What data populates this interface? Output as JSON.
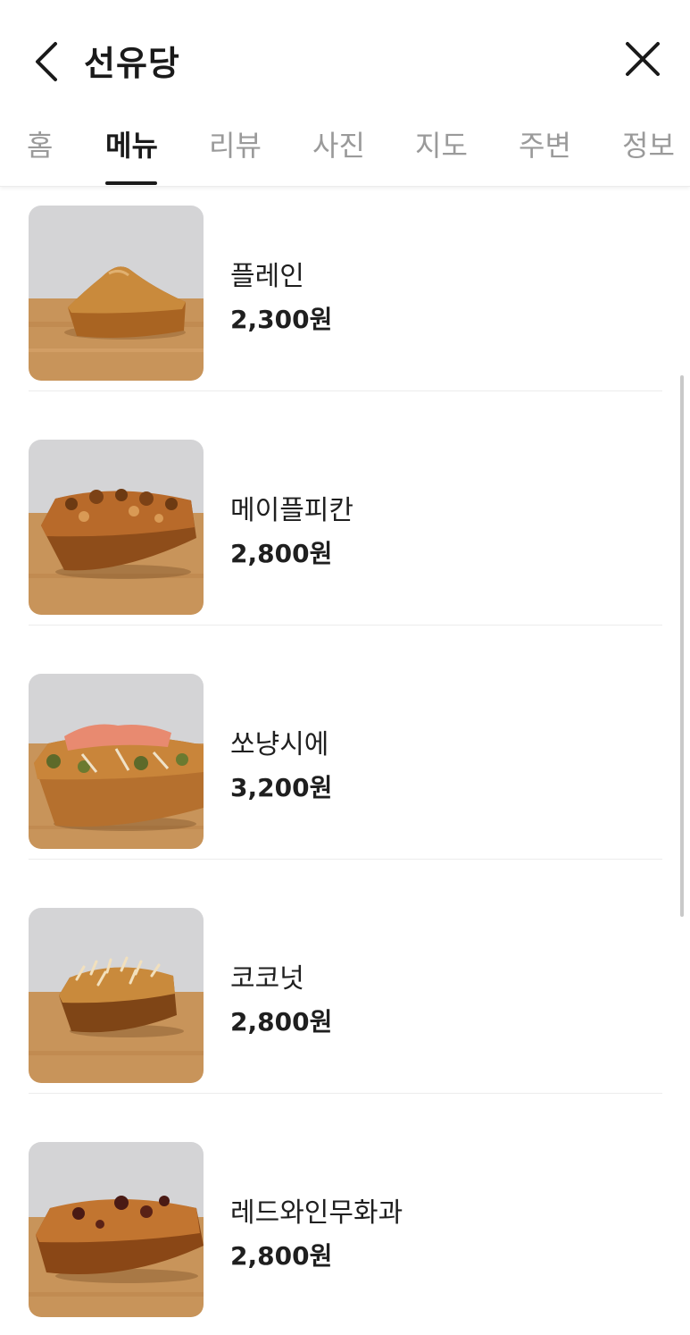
{
  "header": {
    "title": "선유당",
    "back_icon": "chevron-left-icon",
    "close_icon": "close-icon"
  },
  "tabs": [
    {
      "label": "홈",
      "active": false
    },
    {
      "label": "메뉴",
      "active": true
    },
    {
      "label": "리뷰",
      "active": false
    },
    {
      "label": "사진",
      "active": false
    },
    {
      "label": "지도",
      "active": false
    },
    {
      "label": "주변",
      "active": false
    },
    {
      "label": "정보",
      "active": false
    }
  ],
  "menu": {
    "items": [
      {
        "name": "플레인",
        "price": "2,300원"
      },
      {
        "name": "메이플피칸",
        "price": "2,800원"
      },
      {
        "name": "쏘냥시에",
        "price": "3,200원"
      },
      {
        "name": "코코넛",
        "price": "2,800원"
      },
      {
        "name": "레드와인무화과",
        "price": "2,800원"
      }
    ]
  },
  "colors": {
    "text_primary": "#1a1a1a",
    "text_inactive": "#9a9a9a",
    "divider": "#ececec",
    "photo_background": "#d3d3d5",
    "wood": "#c8945a",
    "bread_crust": "#a8621f"
  }
}
